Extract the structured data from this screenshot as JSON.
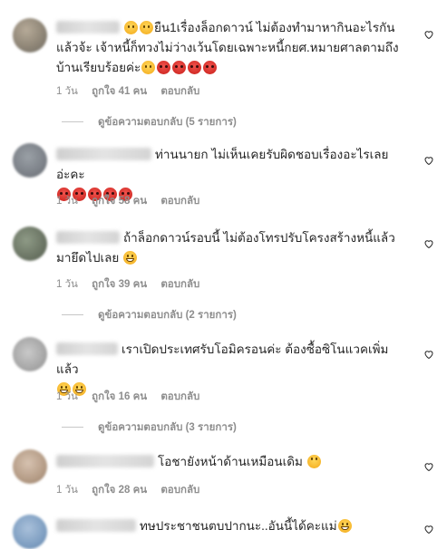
{
  "comments": [
    {
      "text_parts": [
        "ยืน1เรื่องล็อกดาวน์ ไม่ต้องทำมาหากินอะไรกันแล้วจ้ะ เจ้าหนี้ก็ทวงไม่ว่างเว้นโดยเฉพาะหนี้กยศ.หมายศาลตามถึงบ้านเรียบร้อยค่ะ"
      ],
      "time": "1 วัน",
      "likes": "ถูกใจ 41 คน",
      "reply": "ตอบกลับ",
      "view_replies": "ดูข้อความตอบกลับ (5 รายการ)"
    },
    {
      "text_parts": [
        "ท่านนายก ไม่เห็นเคยรับผิดชอบเรื่องอะไรเลยอ่ะคะ"
      ],
      "time": "1 วัน",
      "likes": "ถูกใจ 58 คน",
      "reply": "ตอบกลับ"
    },
    {
      "text_parts": [
        "ถ้าล็อกดาวน์รอบนี้ ไม่ต้องโทรปรับโครงสร้างหนี้แล้ว มายึดไปเลย"
      ],
      "time": "1 วัน",
      "likes": "ถูกใจ 39 คน",
      "reply": "ตอบกลับ",
      "view_replies": "ดูข้อความตอบกลับ (2 รายการ)"
    },
    {
      "text_parts": [
        "เราเปิดประเทศรับโอมิครอนค่ะ ต้องซื้อซิโนแวคเพิ่มแล้ว"
      ],
      "time": "1 วัน",
      "likes": "ถูกใจ 16 คน",
      "reply": "ตอบกลับ",
      "view_replies": "ดูข้อความตอบกลับ (3 รายการ)"
    },
    {
      "text_parts": [
        "โอชายังหน้าด้านเหมือนเดิม"
      ],
      "time": "1 วัน",
      "likes": "ถูกใจ 28 คน",
      "reply": "ตอบกลับ"
    },
    {
      "text_parts": [
        "ทษประชาชนตบปากนะ..อันนี้ได้คะแม่"
      ]
    }
  ],
  "icons": {
    "like": "heart-outline-icon",
    "angry": "angry-face-emoji",
    "grin": "grinning-face-emoji",
    "eyeroll": "face-with-rolling-eyes-emoji"
  },
  "colors": {
    "text": "#262626",
    "meta": "#8e8e8e",
    "angry_emoji": "#d9302a",
    "yellow_emoji": "#f5b324"
  }
}
